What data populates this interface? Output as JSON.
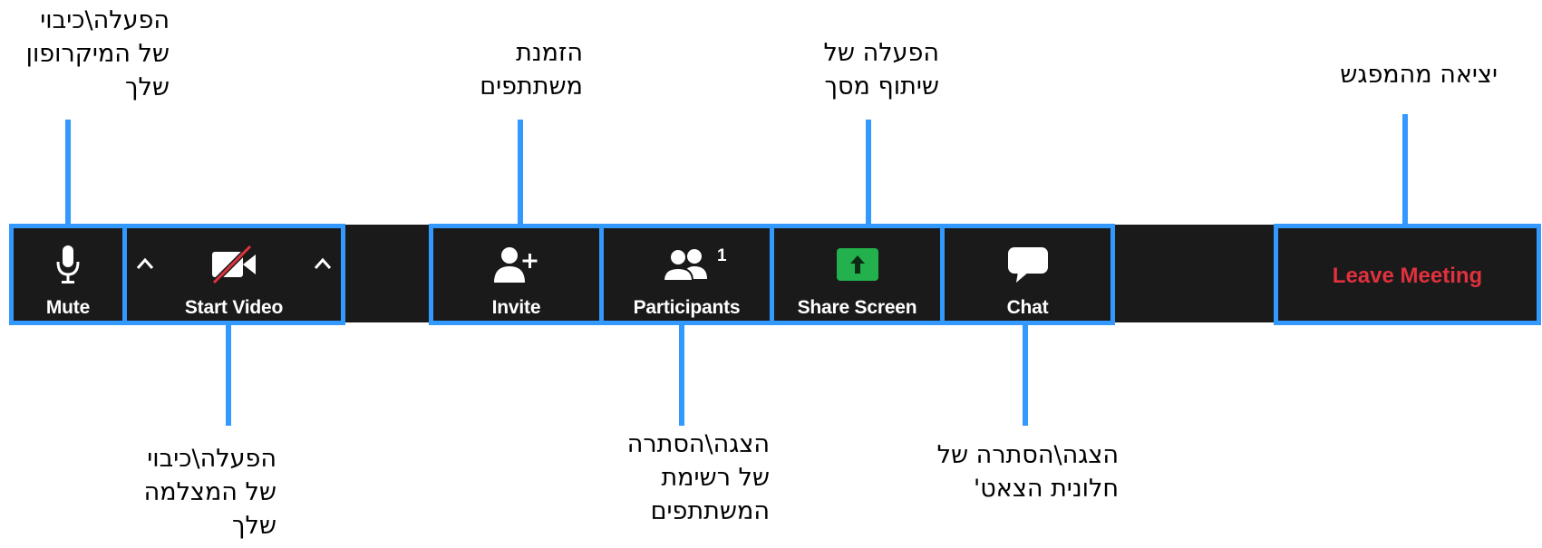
{
  "colors": {
    "toolbar_bg": "#1a1a1a",
    "highlight": "#3399ff",
    "leave_red": "#e0313e",
    "share_green": "#22b14c"
  },
  "toolbar": {
    "mute": {
      "label": "Mute",
      "icon": "microphone-icon"
    },
    "video": {
      "label": "Start Video",
      "icon": "video-off-icon"
    },
    "invite": {
      "label": "Invite",
      "icon": "add-user-icon"
    },
    "participants": {
      "label": "Participants",
      "count": "1",
      "icon": "participants-icon"
    },
    "share": {
      "label": "Share Screen",
      "icon": "share-screen-icon"
    },
    "chat": {
      "label": "Chat",
      "icon": "chat-bubble-icon"
    },
    "leave": {
      "label": "Leave Meeting"
    }
  },
  "annotations": {
    "mute": [
      "הפעלה\\כיבוי",
      "של המיקרופון",
      "שלך"
    ],
    "video": [
      "הפעלה\\כיבוי",
      "של המצלמה",
      "שלך"
    ],
    "invite": [
      "הזמנת",
      "משתתפים"
    ],
    "participants": [
      "הצגה\\הסתרה",
      "של רשימת",
      "המשתתפים"
    ],
    "share": [
      "הפעלה של",
      "שיתוף מסך"
    ],
    "chat": [
      "הצגה\\הסתרה של",
      "חלונית הצאט'"
    ],
    "leave": [
      "יציאה מהמפגש"
    ]
  }
}
